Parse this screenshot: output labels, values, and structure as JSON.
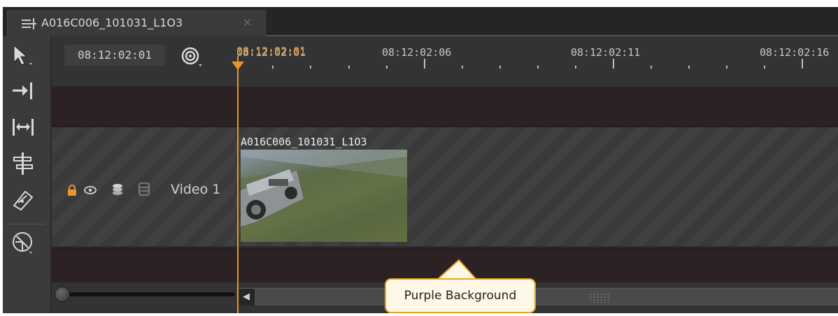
{
  "tab": {
    "title": "A016C006_101031_L1O3",
    "close_glyph": "×",
    "icon": "timeline-icon"
  },
  "toolbar": {
    "tools": [
      "select-tool-icon",
      "trim-to-playhead-icon",
      "fit-range-icon",
      "split-tool-icon",
      "razor-tool-icon",
      "camera-sync-icon"
    ]
  },
  "controls": {
    "timecode": "08:12:02:01",
    "sync_icon": "radio-target-icon"
  },
  "ruler": {
    "playhead_timecode": "08:12:02:01",
    "labels": [
      "08:12:02:01",
      "08:12:02:06",
      "08:12:02:11",
      "08:12:02:16"
    ]
  },
  "track": {
    "name": "Video 1",
    "icons": [
      "lock-icon",
      "eye-icon",
      "layers-icon",
      "database-icon"
    ],
    "clip_name": "A016C006_101031_L1O3"
  },
  "callout": {
    "text": "Purple Background"
  },
  "colors": {
    "accent": "#e8962a",
    "track_band": "#2c2224",
    "panel": "#3b3b3b"
  }
}
